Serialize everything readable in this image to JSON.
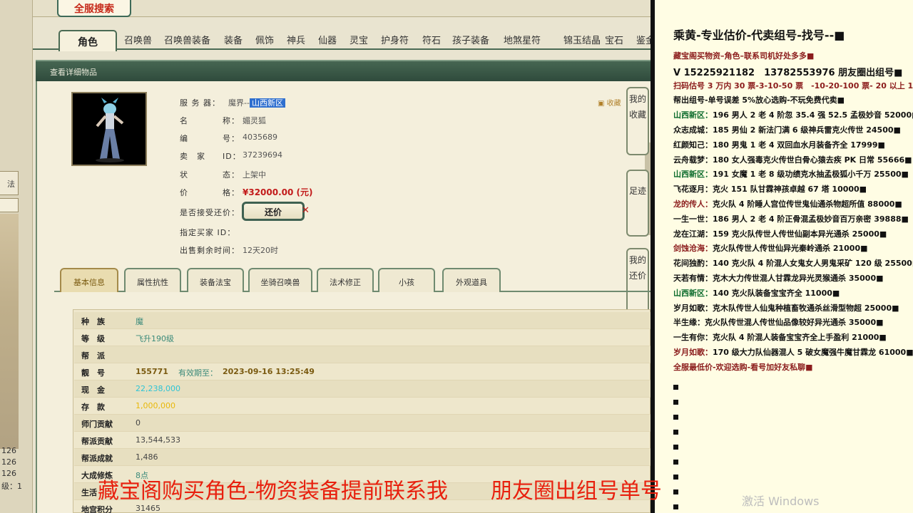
{
  "search_logo": "全服搜索",
  "main_tabs": [
    "角色",
    "召唤兽",
    "召唤兽装备",
    "装备",
    "佩饰",
    "神兵",
    "仙器",
    "灵宝",
    "护身符",
    "符石",
    "孩子装备",
    "地煞星符",
    "锦玉结晶",
    "宝石",
    "鉴金"
  ],
  "section_title": "查看详细物品",
  "collect_link": "收藏",
  "info": {
    "server_label": "服 务 器：",
    "server_prefix": "魔界--",
    "server_highlight": "山西新区",
    "name_label": "名",
    "name_label2": "称：",
    "name_value": "媚灵狐",
    "code_label": "编",
    "code_label2": "号：",
    "code_value": "4035689",
    "seller_label": "卖　家",
    "seller_label2": "ID：",
    "seller_value": "37239694",
    "status_label": "状",
    "status_label2": "态：",
    "status_value": "上架中",
    "price_label": "价",
    "price_label2": "格：",
    "price_value": "¥32000.00 (元)",
    "counter_label": "是否接受还价：",
    "counter_button": "还价",
    "buyer_label": "指定买家 ID：",
    "remain_label": "出售剩余时间：",
    "remain_value": "12天20时"
  },
  "side_tabs": [
    "我的收藏",
    "足迹",
    "我的还价"
  ],
  "sub_tabs": [
    "基本信息",
    "属性抗性",
    "装备法宝",
    "坐骑召唤兽",
    "法术修正",
    "小孩",
    "外观道具"
  ],
  "table_rows": [
    {
      "label": "种　族",
      "value": "魔"
    },
    {
      "label": "等　级",
      "value": "飞升190级"
    },
    {
      "label": "帮　派",
      "value": ""
    },
    {
      "label": "靓　号",
      "value": "155771",
      "extra": "有效期至：",
      "extra2": "2023-09-16 13:25:49"
    },
    {
      "label": "现　金",
      "value": "22,238,000"
    },
    {
      "label": "存　款",
      "value": "1,000,000"
    },
    {
      "label": "师门贡献",
      "value": "0"
    },
    {
      "label": "帮派贡献",
      "value": "13,544,533"
    },
    {
      "label": "帮派成就",
      "value": "1,486"
    },
    {
      "label": "大成修炼",
      "value": "8点"
    },
    {
      "label": "生活",
      "value": ""
    },
    {
      "label": "地宫积分",
      "value": "31465"
    }
  ],
  "left_strip": {
    "tab_label": "法",
    "nums": [
      "126",
      "126",
      "126",
      "级：1"
    ]
  },
  "overlay_banner": "藏宝阁购买角色-物资装备提前联系我　　朋友圈出组号单号",
  "activate_text": "激活 Windows",
  "right": {
    "corner_logo": "水印",
    "heading": "乘黄-专业估价-代卖组号-找号--■",
    "lines": [
      {
        "text": "藏宝阁买物资–角色–联系司机好处多多■",
        "style": "red"
      },
      {
        "text": "V 15225921182　13782553976 朋友圈出组号■",
        "style": "big"
      },
      {
        "text": "扫码估号 3 万内 30 票-3-10-50 票　-10-20-100 票- 20 以上 150■",
        "style": "red"
      },
      {
        "text": "帮出组号-单号误差 5%放心选购-不玩免费代卖■",
        "style": ""
      },
      {
        "name": "山西新区：",
        "nameStyle": "green",
        "text": "196 男人 2 老 4 阶忽 35.4 强 52.5 孟极妙音 52000■"
      },
      {
        "name": "众志成城：",
        "nameStyle": "",
        "text": "185 男仙 2 新法门满 6 级神兵雷克火传世 24500■"
      },
      {
        "name": "红颜知己：",
        "nameStyle": "",
        "text": "180 男鬼 1 老 4 双回血水月装备齐全 17999■"
      },
      {
        "name": "云舟载梦：",
        "nameStyle": "",
        "text": "180 女人强毒克火传世白骨心猿去疾 PK 日常 55666■"
      },
      {
        "name": "山西新区：",
        "nameStyle": "green",
        "text": "191 女魔 1 老 8 级功绩克水抽孟极狐小千万 25500■"
      },
      {
        "name": "飞花逐月：",
        "nameStyle": "",
        "text": "克火 151 队甘霖神孩卓越 67 塔 10000■"
      },
      {
        "name": "龙的传人：",
        "nameStyle": "red",
        "text": "克火队 4 阶睡人宫位传世鬼仙通杀物超所值 88000■"
      },
      {
        "name": "一生一世：",
        "nameStyle": "",
        "text": "186 男人 2 老 4 阶正骨混孟极妙音百万亲密 39888■"
      },
      {
        "name": "龙在江湖：",
        "nameStyle": "",
        "text": "159 克火队传世人传世仙副本异光通杀 25000■"
      },
      {
        "name": "剑蚀沧海：",
        "nameStyle": "red",
        "text": "克火队传世人传世仙异光秦岭通杀 21000■"
      },
      {
        "name": "花间独酌：",
        "nameStyle": "",
        "text": "140 克火队 4 阶混人女鬼女人男鬼采矿 120 级 25500■"
      },
      {
        "name": "天若有情：",
        "nameStyle": "",
        "text": "克木大力传世混人甘霖龙异光灵猴通杀 35000■"
      },
      {
        "name": "山西新区：",
        "nameStyle": "green",
        "text": "140 克火队装备宝宝齐全 11000■"
      },
      {
        "name": "岁月如歌：",
        "nameStyle": "",
        "text": "克木队传世人仙鬼种植畜牧通杀丝滑型物超 25000■"
      },
      {
        "name": "半生缘：",
        "nameStyle": "",
        "text": "克火队传世混人传世仙品像较好异光通杀 35000■"
      },
      {
        "name": "一生有你：",
        "nameStyle": "",
        "text": "克火队 4 阶混人装备宝宝齐全上手盈利 21000■"
      },
      {
        "name": "岁月如歌：",
        "nameStyle": "red",
        "text": "170 级大力队仙器混人 5 破女魔强牛魔甘霖龙 61000■"
      },
      {
        "text": "全服最低价-欢迎选购-看号加好友私聊■",
        "style": "red"
      }
    ],
    "bullets_count": 9
  }
}
